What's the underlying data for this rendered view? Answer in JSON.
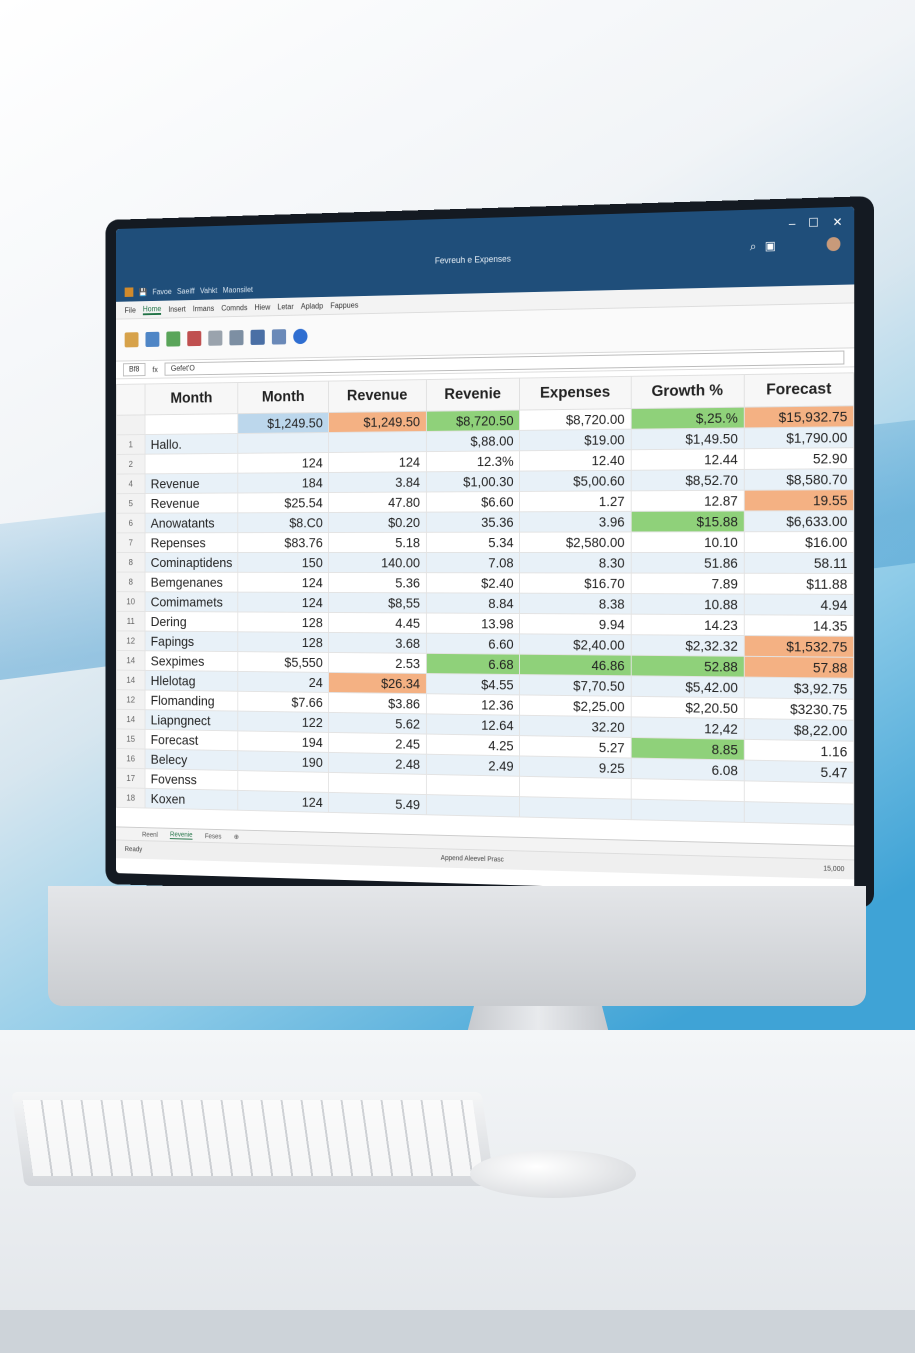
{
  "window": {
    "title": "Fevreuh e Expenses",
    "controls": [
      "–",
      "☐",
      "✕"
    ]
  },
  "quick_access": {
    "items": [
      "File",
      "Favoe",
      "Saeiff",
      "Vahkt",
      "Maonsilet"
    ]
  },
  "ribbon_tabs": [
    "File",
    "Home",
    "Insert",
    "Irmans",
    "Comnds",
    "Hiew",
    "Letar",
    "Apladp",
    "Fappues"
  ],
  "ribbon_active": "Home",
  "formula_bar": {
    "name_box": "Bf8",
    "formula": "Gefet'O"
  },
  "grid": {
    "headers": [
      "Month",
      "Month",
      "Revenue",
      "Revenie",
      "Expenses",
      "Growth %",
      "Forecast"
    ],
    "top_row": [
      "",
      "$1,249.50",
      "$1,249.50",
      "$8,720.50",
      "$8,720.00",
      "$,25.%",
      "$15,932.75"
    ],
    "rows": [
      {
        "n": "1",
        "c": [
          "Hallo.",
          "",
          "",
          "$,88.00",
          "$19.00",
          "$1,49.50",
          "$1,790.00"
        ]
      },
      {
        "n": "2",
        "c": [
          "",
          "124",
          "124",
          "12.3%",
          "12.40",
          "12.44",
          "52.90"
        ]
      },
      {
        "n": "4",
        "c": [
          "Revenue",
          "184",
          "3.84",
          "$1,00.30",
          "$5,00.60",
          "$8,52.70",
          "$8,580.70"
        ]
      },
      {
        "n": "5",
        "c": [
          "Revenue",
          "$25.54",
          "47.80",
          "$6.60",
          "1.27",
          "12.87",
          "19.55"
        ]
      },
      {
        "n": "6",
        "c": [
          "Anowatants",
          "$8.C0",
          "$0.20",
          "35.36",
          "3.96",
          "$15.88",
          "$6,633.00"
        ]
      },
      {
        "n": "7",
        "c": [
          "Repenses",
          "$83.76",
          "5.18",
          "5.34",
          "$2,580.00",
          "10.10",
          "$16.00"
        ]
      },
      {
        "n": "8",
        "c": [
          "Cominaptidens",
          "150",
          "140.00",
          "7.08",
          "8.30",
          "51.86",
          "58.11"
        ]
      },
      {
        "n": "8",
        "c": [
          "Bemgenanes",
          "124",
          "5.36",
          "$2.40",
          "$16.70",
          "7.89",
          "$11.88"
        ]
      },
      {
        "n": "10",
        "c": [
          "Comimamets",
          "124",
          "$8,55",
          "8.84",
          "8.38",
          "10.88",
          "4.94"
        ]
      },
      {
        "n": "11",
        "c": [
          "Dering",
          "128",
          "4.45",
          "13.98",
          "9.94",
          "14.23",
          "14.35"
        ]
      },
      {
        "n": "12",
        "c": [
          "Fapings",
          "128",
          "3.68",
          "6.60",
          "$2,40.00",
          "$2,32.32",
          "$1,532.75"
        ]
      },
      {
        "n": "14",
        "c": [
          "Sexpimes",
          "$5,550",
          "2.53",
          "6.68",
          "46.86",
          "52.88",
          "57.88"
        ]
      },
      {
        "n": "14",
        "c": [
          "Hlelotag",
          "24",
          "$26.34",
          "$4.55",
          "$7,70.50",
          "$5,42.00",
          "$3,92.75"
        ]
      },
      {
        "n": "12",
        "c": [
          "Flomanding",
          "$7.66",
          "$3.86",
          "12.36",
          "$2,25.00",
          "$2,20.50",
          "$3230.75"
        ]
      },
      {
        "n": "14",
        "c": [
          "Liapngnect",
          "122",
          "5.62",
          "12.64",
          "32.20",
          "12,42",
          "$8,22.00"
        ]
      },
      {
        "n": "15",
        "c": [
          "Forecast",
          "194",
          "2.45",
          "4.25",
          "5.27",
          "8.85",
          "1.16"
        ]
      },
      {
        "n": "16",
        "c": [
          "Belecy",
          "190",
          "2.48",
          "2.49",
          "9.25",
          "6.08",
          "5.47"
        ]
      },
      {
        "n": "17",
        "c": [
          "Fovenss",
          "",
          "",
          "",
          "",
          "",
          ""
        ]
      },
      {
        "n": "18",
        "c": [
          "Koxen",
          "124",
          "5.49",
          "",
          "",
          "",
          ""
        ]
      }
    ]
  },
  "sheet_tabs": [
    "Reenl",
    "Revenie",
    "Feses"
  ],
  "sheet_active": "Revenie",
  "status": {
    "left": "Ready",
    "right_label": "Append Aleevel Prasc",
    "zoom": "15,000"
  },
  "colors": {
    "titlebar": "#1f4e7a",
    "highlight_orange": "#f4b183",
    "highlight_green": "#8fd17a",
    "highlight_blue": "#bcd7ec",
    "row_band": "#e8f1f8"
  }
}
